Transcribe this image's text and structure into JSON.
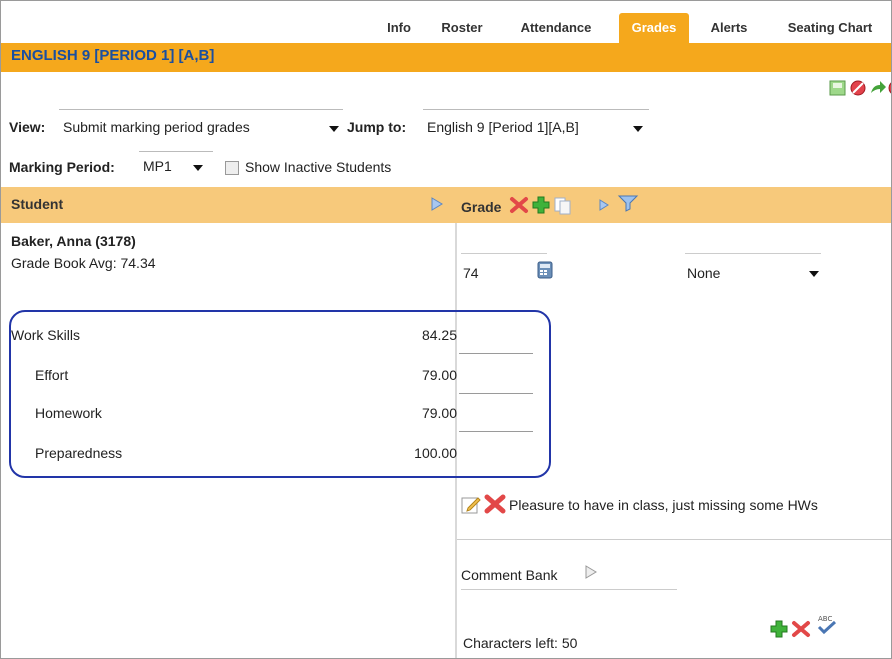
{
  "tabs": [
    "Info",
    "Roster",
    "Attendance",
    "Grades",
    "Alerts",
    "Seating Chart"
  ],
  "active_tab": "Grades",
  "class_title": "ENGLISH 9 [PERIOD 1] [A,B]",
  "view": {
    "label": "View:",
    "value": "Submit marking period grades"
  },
  "jump_to": {
    "label": "Jump to:",
    "value": "English 9 [Period 1][A,B]"
  },
  "marking_period": {
    "label": "Marking Period:",
    "value": "MP1"
  },
  "show_inactive": {
    "label": "Show Inactive Students",
    "checked": false
  },
  "columns": {
    "student": "Student",
    "grade": "Grade"
  },
  "student": {
    "name": "Baker, Anna (3178)",
    "gradebook_avg": "Grade Book Avg: 74.34"
  },
  "skills": [
    {
      "name": "Work Skills",
      "value": "84.25"
    },
    {
      "name": "Effort",
      "value": "79.00"
    },
    {
      "name": "Homework",
      "value": "79.00"
    },
    {
      "name": "Preparedness",
      "value": "100.00"
    }
  ],
  "grade_value": "74",
  "grade_select": "None",
  "comment": "Pleasure to have in class, just missing some HWs",
  "comment_bank_label": "Comment Bank",
  "characters_left": "Characters left: 50",
  "colors": {
    "accent": "#f5a81c",
    "header": "#f7c97b",
    "title": "#1a4fa0",
    "highlight": "#2235a8"
  }
}
